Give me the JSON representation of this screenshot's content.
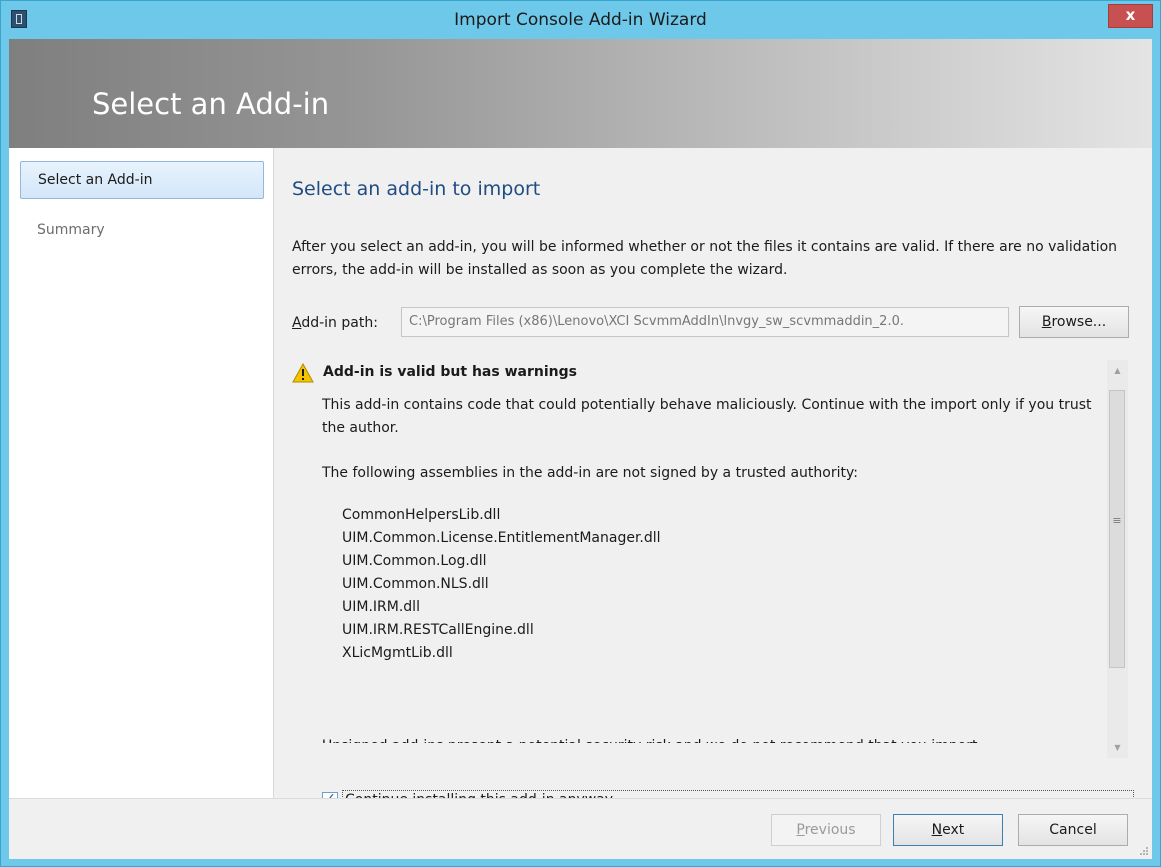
{
  "window": {
    "title": "Import Console Add-in Wizard",
    "close_label": "x"
  },
  "banner": {
    "title": "Select an Add-in"
  },
  "sidebar": {
    "items": [
      {
        "label": "Select an Add-in",
        "active": true
      },
      {
        "label": "Summary",
        "active": false
      }
    ]
  },
  "main": {
    "heading": "Select an add-in to import",
    "description": "After you select an add-in, you will be informed whether or not the files it contains are valid. If there are no validation errors, the add-in will be installed as soon as you complete the wizard.",
    "path_label_underlined": "A",
    "path_label_rest": "dd-in path:",
    "path_value": "C:\\Program Files (x86)\\Lenovo\\XCI ScvmmAddIn\\lnvgy_sw_scvmmaddin_2.0.",
    "browse_label_underlined": "B",
    "browse_label_rest": "rowse..."
  },
  "warning": {
    "title": "Add-in is valid but has warnings",
    "message": "This add-in contains code that could potentially behave maliciously. Continue with the import only if you trust the author.",
    "assemblies_intro": "The following assemblies in the add-in are not signed by a trusted authority:",
    "assemblies": [
      "CommonHelpersLib.dll",
      "UIM.Common.License.EntitlementManager.dll",
      "UIM.Common.Log.dll",
      "UIM.Common.NLS.dll",
      "UIM.IRM.dll",
      "UIM.IRM.RESTCallEngine.dll",
      "XLicMgmtLib.dll"
    ],
    "cutoff_text": "Unsigned add-ins present a potential security risk and we do not recommend that you import"
  },
  "continue_checkbox": {
    "label": "Continue installing this add-in anyway",
    "checked": true
  },
  "footer": {
    "previous_underlined": "P",
    "previous_rest": "revious",
    "next_underlined": "N",
    "next_rest": "ext",
    "cancel_label": "Cancel"
  },
  "colors": {
    "title_bar": "#6dc8ea",
    "close_button": "#c75050",
    "heading_blue": "#1f4c83",
    "warning_yellow": "#f5c400"
  },
  "icons": {
    "app": "console-app-icon",
    "warning": "warning-triangle-icon",
    "close": "close-icon"
  }
}
